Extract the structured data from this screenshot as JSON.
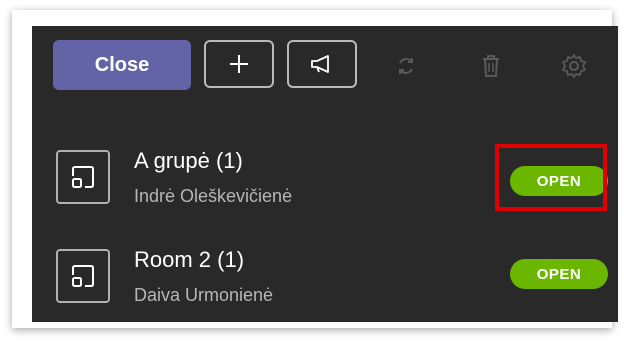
{
  "toolbar": {
    "close_label": "Close",
    "add_icon": "plus-icon",
    "announce_icon": "megaphone-icon",
    "refresh_icon": "refresh-icon",
    "delete_icon": "trash-icon",
    "settings_icon": "gear-icon"
  },
  "rooms": [
    {
      "name": "A grupė (1)",
      "participant": "Indrė Oleškevičienė",
      "status": "OPEN",
      "highlighted": true
    },
    {
      "name": "Room 2 (1)",
      "participant": "Daiva Urmonienė",
      "status": "OPEN",
      "highlighted": false
    }
  ],
  "colors": {
    "panel_bg": "#292929",
    "accent": "#6264a7",
    "status_open": "#6bb700",
    "highlight_box": "#e00000"
  }
}
